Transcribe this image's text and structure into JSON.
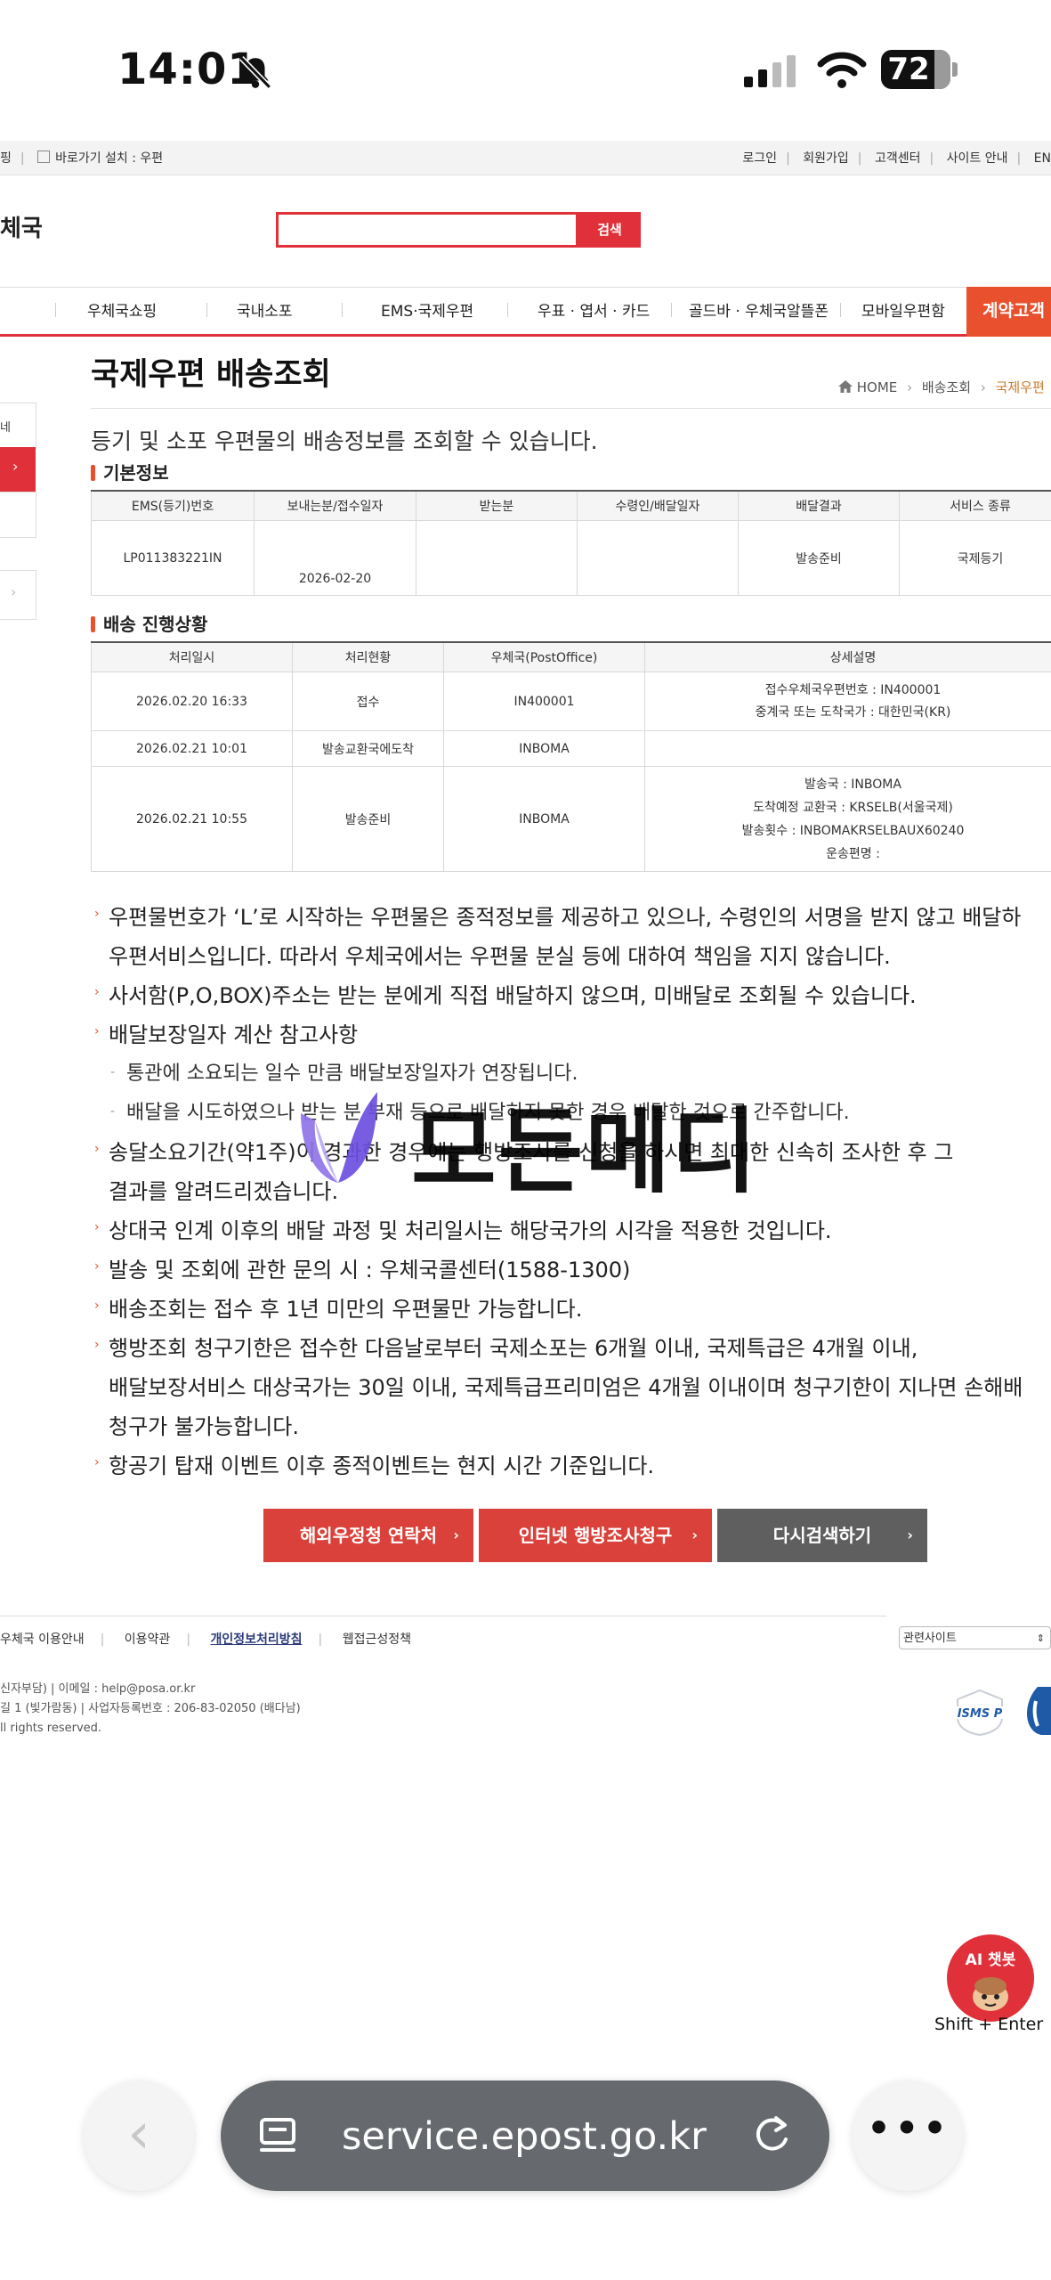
{
  "status_bar": {
    "time": "14:01",
    "battery": "72"
  },
  "util_bar": {
    "left_items": [
      "핑",
      "바로가기 설치 : 우편"
    ],
    "right_items": [
      "로그인",
      "회원가입",
      "고객센터",
      "사이트 안내",
      "EN"
    ]
  },
  "header": {
    "logo_text": "체국",
    "search_button": "검색",
    "search_value": ""
  },
  "gnb": {
    "items": [
      "우체국쇼핑",
      "국내소포",
      "EMS·국제우편",
      "우표 · 엽서 · 카드",
      "골드바 · 우체국알뜰폰",
      "모바일우편함"
    ],
    "active": "계약고객"
  },
  "lnb": {
    "partial_label": "네",
    "arrow": "›"
  },
  "page": {
    "title": "국제우편 배송조회",
    "breadcrumb": [
      "HOME",
      "배송조회",
      "국제우편"
    ],
    "intro": "등기 및 소포 우편물의 배송정보를 조회할 수 있습니다."
  },
  "basic_info": {
    "title": "기본정보",
    "headers": [
      "EMS(등기)번호",
      "보내는분/접수일자",
      "받는분",
      "수령인/배달일자",
      "배달결과",
      "서비스 종류"
    ],
    "row": [
      "LP011383221IN",
      "2026-02-20",
      "",
      "",
      "발송준비",
      "국제등기"
    ]
  },
  "progress": {
    "title": "배송 진행상황",
    "headers": [
      "처리일시",
      "처리현황",
      "우체국(PostOffice)",
      "상세설명"
    ],
    "rows": [
      {
        "datetime": "2026.02.20 16:33",
        "status": "접수",
        "office": "IN400001",
        "detail": [
          "접수우체국우편번호 : IN400001",
          "중계국 또는 도착국가 : 대한민국(KR)"
        ]
      },
      {
        "datetime": "2026.02.21 10:01",
        "status": "발송교환국에도착",
        "office": "INBOMA",
        "detail": []
      },
      {
        "datetime": "2026.02.21 10:55",
        "status": "발송준비",
        "office": "INBOMA",
        "detail": [
          "발송국 : INBOMA",
          "도착예정 교환국 : KRSELB(서울국제)",
          "발송횟수 : INBOMAKRSELBAUX60240",
          "운송편명 :"
        ]
      }
    ]
  },
  "notes": [
    {
      "type": "main",
      "text": "우편물번호가 ‘L’로 시작하는 우편물은 종적정보를 제공하고 있으나, 수령인의 서명을 받지 않고 배달하"
    },
    {
      "type": "cont",
      "text": "우편서비스입니다. 따라서 우체국에서는 우편물 분실 등에 대하여 책임을 지지 않습니다."
    },
    {
      "type": "main",
      "text": "사서함(P,O,BOX)주소는 받는 분에게 직접 배달하지 않으며, 미배달로 조회될 수 있습니다."
    },
    {
      "type": "main",
      "text": "배달보장일자 계산 참고사항"
    },
    {
      "type": "sub",
      "text": "통관에 소요되는 일수 만큼 배달보장일자가 연장됩니다."
    },
    {
      "type": "sub",
      "text": "배달을 시도하였으나 받는 분 부재 등으로 배달하지 못한 경우 배달한 것으로 간주합니다."
    },
    {
      "type": "main",
      "text": "송달소요기간(약1주)이 경과한 경우에는 행방조사를 신청을 하시면 최대한 신속히 조사한 후 그"
    },
    {
      "type": "cont",
      "text": "결과를 알려드리겠습니다."
    },
    {
      "type": "main",
      "text": "상대국 인계 이후의 배달 과정 및 처리일시는 해당국가의 시각을 적용한 것입니다."
    },
    {
      "type": "main",
      "text": "발송 및 조회에 관한 문의 시 : 우체국콜센터(1588-1300)"
    },
    {
      "type": "main",
      "text": "배송조회는 접수 후 1년 미만의 우편물만 가능합니다."
    },
    {
      "type": "main",
      "text": "행방조회 청구기한은 접수한 다음날로부터 국제소포는 6개월 이내, 국제특급은 4개월 이내,"
    },
    {
      "type": "cont",
      "text": "배달보장서비스 대상국가는 30일 이내, 국제특급프리미엄은 4개월 이내이며 청구기한이 지나면 손해배"
    },
    {
      "type": "cont",
      "text": "청구가 불가능합니다."
    },
    {
      "type": "main",
      "text": "항공기 탑재 이벤트 이후 종적이벤트는 현지 시간 기준입니다."
    }
  ],
  "watermark": {
    "text": "모든메디"
  },
  "buttons": [
    {
      "label": "해외우정청 연락처",
      "color": "#d9413a"
    },
    {
      "label": "인터넷 행방조사청구",
      "color": "#d9413a"
    },
    {
      "label": "다시검색하기",
      "color": "#5f5f5f"
    }
  ],
  "footer": {
    "links": [
      "우체국 이용안내",
      "이용약관",
      "개인정보처리방침",
      "웹접근성정책"
    ],
    "related_sites": "관련사이트",
    "info_lines": [
      "신자부담)  |  이메일 : help@posa.or.kr",
      "길 1 (빛가람동)  |  사업자등록번호 : 206-83-02050 (배다남)",
      "ll rights reserved."
    ],
    "cert_label": "ISMS P"
  },
  "chatbot": {
    "label": "AI 챗봇",
    "hint": "Shift + Enter"
  },
  "browser": {
    "url": "service.epost.go.kr"
  },
  "colors": {
    "accent_red": "#e0303a",
    "accent_orange": "#e8502e",
    "dark_button": "#5f5f5f"
  }
}
